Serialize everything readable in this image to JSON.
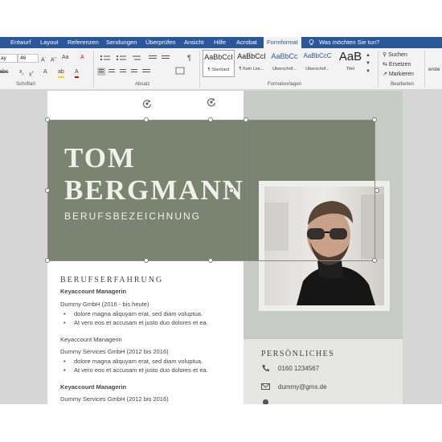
{
  "ribbon": {
    "tabs": [
      "Entwurf",
      "Layout",
      "Referenzen",
      "Sendungen",
      "Überprüfen",
      "Ansicht",
      "Hilfe",
      "Acrobat",
      "Formformat"
    ],
    "active_tab": "Formformat",
    "tell_me": "Was möchten Sie tun?",
    "font_name_fragment": "ay",
    "font_size": "46",
    "groups": {
      "font": "Schriftart",
      "paragraph": "Absatz",
      "styles": "Formatvorlagen",
      "editing": "Bearbeiten"
    },
    "styles": [
      {
        "preview": "AaBbCcI",
        "name": "¶ Standard"
      },
      {
        "preview": "AaBbCcI",
        "name": "¶ Kein Lee..."
      },
      {
        "preview": "AaBbCc",
        "name": "Überschrif..."
      },
      {
        "preview": "AaBbCcC",
        "name": "Überschrif..."
      },
      {
        "preview": "AaB",
        "name": "Titel"
      }
    ],
    "editing": {
      "search": "Suchen",
      "replace": "Ersetzen",
      "select": "Markieren"
    },
    "cut_off_right": "erste"
  },
  "document": {
    "first_name": "TOM",
    "last_name": "BERGMANN",
    "job_title": "BERUFSBEZEICHNUNG",
    "experience_heading": "BERUFSERFAHRUNG",
    "experience": [
      {
        "title": "Keyaccount Managerin",
        "company": "Dummy GmbH (2016 - bis heute)",
        "bullets": [
          "dolore magna aliquyam erat, sed diam voluptua.",
          "At vero eos et accusam et justo duo dolores et ea."
        ]
      },
      {
        "title": "Keyaccount Managerin",
        "company": "Dummy Services GmbH (2012 bis 2016)",
        "bullets": [
          "dolore magna aliquyam erat, sed diam voluptua.",
          "At vero eos et accusam et justo duo dolores et ea."
        ]
      },
      {
        "title": "Keyaccount Managerin",
        "company": "Dummy Services GmbH (2012 bis 2016)",
        "bullets": []
      }
    ],
    "personal_heading": "PERSÖNLICHES",
    "phone": "0160  1234567",
    "email": "dummy@gmx.de"
  },
  "colors": {
    "ribbon_blue": "#2b579a",
    "header_green": "#7b8470",
    "sidebar_gray": "#c8cac5"
  },
  "icons": [
    "lightbulb-icon",
    "search-icon",
    "replace-icon",
    "select-icon",
    "phone-icon",
    "mail-icon",
    "location-icon",
    "rotate-handle-icon"
  ]
}
